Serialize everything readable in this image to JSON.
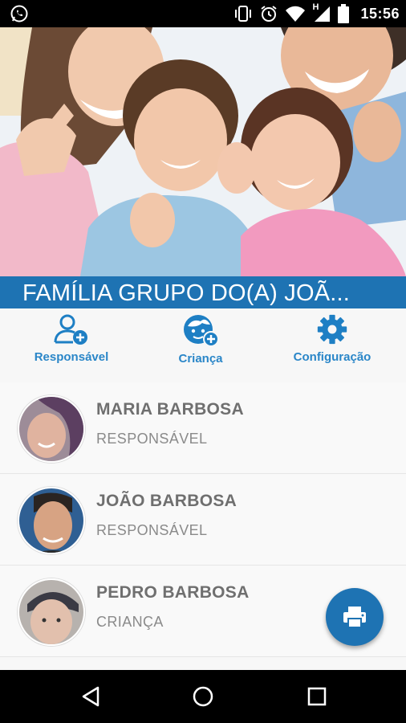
{
  "status_bar": {
    "time": "15:56",
    "network_letter": "H",
    "icons": [
      "whatsapp-icon",
      "vibrate-icon",
      "alarm-icon",
      "wifi-icon",
      "signal-icon",
      "battery-icon"
    ]
  },
  "banner": {
    "title": "FAMÍLIA GRUPO DO(A) JOÃ..."
  },
  "actions": [
    {
      "label": "Responsável",
      "icon": "add-person-icon"
    },
    {
      "label": "Criança",
      "icon": "add-child-icon"
    },
    {
      "label": "Configuração",
      "icon": "gear-icon"
    }
  ],
  "members": [
    {
      "name": "MARIA BARBOSA",
      "role": "RESPONSÁVEL"
    },
    {
      "name": "JOÃO BARBOSA",
      "role": "RESPONSÁVEL"
    },
    {
      "name": "PEDRO BARBOSA",
      "role": "CRIANÇA"
    }
  ],
  "fab": {
    "icon": "print-icon"
  },
  "colors": {
    "primary": "#1e73b3",
    "accent_text": "#2a86c8",
    "name_text": "#6f6f6f",
    "role_text": "#8a8a8a"
  }
}
